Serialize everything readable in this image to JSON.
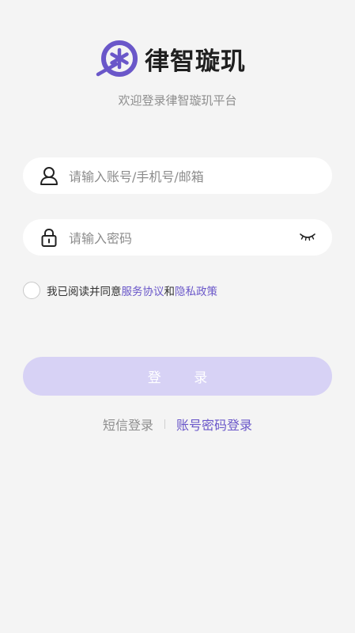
{
  "brand": {
    "name": "律智璇玑",
    "welcome": "欢迎登录律智璇玑平台",
    "accent": "#6a57c9"
  },
  "form": {
    "account_placeholder": "请输入账号/手机号/邮箱",
    "password_placeholder": "请输入密码",
    "account_icon": "user-icon",
    "password_icon": "lock-icon",
    "visibility_icon": "eye-closed-icon"
  },
  "agreement": {
    "prefix": "我已阅读并同意",
    "service_link": "服务协议",
    "conjunction": "和",
    "privacy_link": "隐私政策",
    "checked": false
  },
  "login_button": {
    "label": "登 录",
    "color": "#d7d2f5"
  },
  "alt_login": {
    "sms": "短信登录",
    "password": "账号密码登录"
  }
}
